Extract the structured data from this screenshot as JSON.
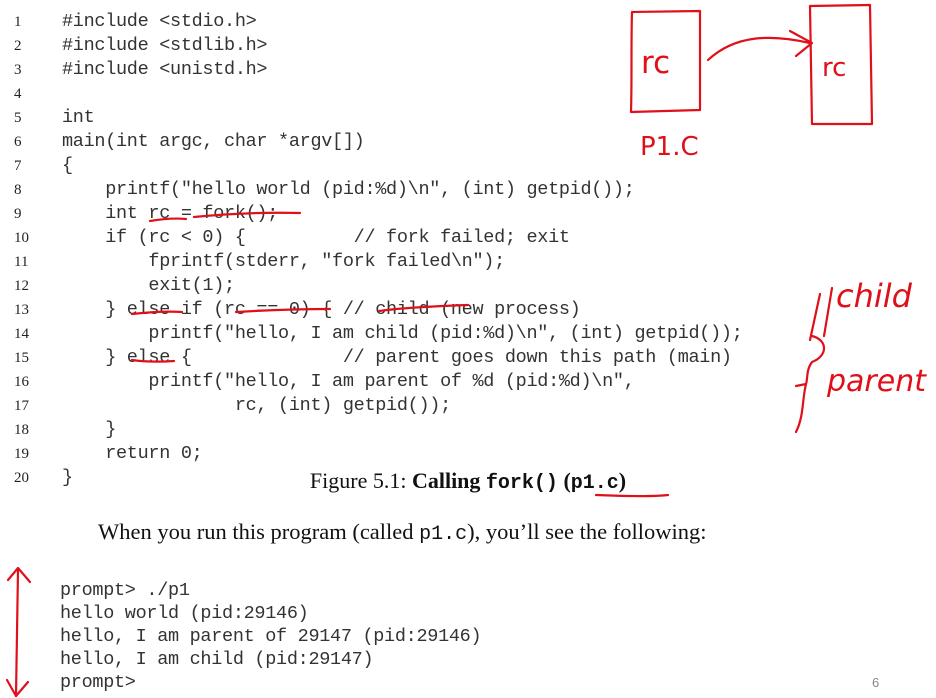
{
  "code": {
    "lines": [
      {
        "num": "1",
        "text": "#include <stdio.h>"
      },
      {
        "num": "2",
        "text": "#include <stdlib.h>"
      },
      {
        "num": "3",
        "text": "#include <unistd.h>"
      },
      {
        "num": "4",
        "text": ""
      },
      {
        "num": "5",
        "text": "int"
      },
      {
        "num": "6",
        "text": "main(int argc, char *argv[])"
      },
      {
        "num": "7",
        "text": "{"
      },
      {
        "num": "8",
        "text": "    printf(\"hello world (pid:%d)\\n\", (int) getpid());"
      },
      {
        "num": "9",
        "text": "    int rc = fork();"
      },
      {
        "num": "10",
        "text": "    if (rc < 0) {          // fork failed; exit"
      },
      {
        "num": "11",
        "text": "        fprintf(stderr, \"fork failed\\n\");"
      },
      {
        "num": "12",
        "text": "        exit(1);"
      },
      {
        "num": "13",
        "text": "    } else if (rc == 0) { // child (new process)"
      },
      {
        "num": "14",
        "text": "        printf(\"hello, I am child (pid:%d)\\n\", (int) getpid());"
      },
      {
        "num": "15",
        "text": "    } else {              // parent goes down this path (main)"
      },
      {
        "num": "16",
        "text": "        printf(\"hello, I am parent of %d (pid:%d)\\n\","
      },
      {
        "num": "17",
        "text": "                rc, (int) getpid());"
      },
      {
        "num": "18",
        "text": "    }"
      },
      {
        "num": "19",
        "text": "    return 0;"
      },
      {
        "num": "20",
        "text": "}"
      }
    ]
  },
  "caption": {
    "prefix": "Figure 5.1: ",
    "bold_text": "Calling ",
    "func": "fork()",
    "paren_open": " (",
    "file": "p1.c",
    "paren_close": ")"
  },
  "paragraph": {
    "before": "When you run this program (called ",
    "code": "p1.c",
    "after": "), you’ll see the following:"
  },
  "output": {
    "lines": [
      "prompt> ./p1",
      "hello world (pid:29146)",
      "hello, I am parent of 29147 (pid:29146)",
      "hello, I am child (pid:29147)",
      "prompt>"
    ]
  },
  "annotations": {
    "box_left_label": "rc",
    "box_right_label": "rc",
    "box_caption": "P1.C",
    "child_label": "child",
    "parent_label": "parent",
    "ink_color": "#e0101a"
  },
  "page_number": "6"
}
